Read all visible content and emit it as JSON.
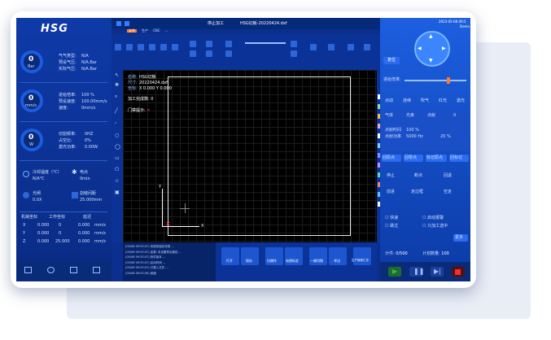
{
  "logo": "HSG",
  "left": {
    "gauges": [
      {
        "value": "0",
        "unit": "Bar"
      },
      {
        "value": "0",
        "unit": "mm/s"
      },
      {
        "value": "0",
        "unit": "W"
      }
    ],
    "gas_rows": [
      "气气类型:",
      "预设气压:",
      "实际气压:"
    ],
    "gas_vals": [
      "N/A",
      "N/A.Bar",
      "N/A.Bar"
    ],
    "speed_rows": [
      "进给倍率:",
      "预设速度:",
      "速度:"
    ],
    "speed_vals": [
      "100 %",
      "100.00mm/s",
      "0mm/s"
    ],
    "power_rows": [
      "切割频率:",
      "占空比:",
      "激光功率:"
    ],
    "power_vals": [
      "0HZ",
      "0%",
      "0.00W"
    ],
    "mid_items": [
      {
        "label": "冷却温度（℃）",
        "val": "N/A℃"
      },
      {
        "label": "电点",
        "val": "0min"
      },
      {
        "label": "光闸",
        "val": "0.0X"
      },
      {
        "label": "割缝间距",
        "val": "25.000mm"
      }
    ],
    "coord_headers": [
      "机械坐标",
      "工作坐标",
      "延迟",
      ""
    ],
    "coords": [
      {
        "axis": "X",
        "mech": "0.000",
        "work": "0",
        "delay": "0.000",
        "unit": "mm/s"
      },
      {
        "axis": "Y",
        "mech": "0.000",
        "work": "0",
        "delay": "0.000",
        "unit": "mm/s"
      },
      {
        "axis": "Z",
        "mech": "0.000",
        "work": "25.000",
        "delay": "0.000",
        "unit": "mm/s"
      }
    ]
  },
  "top": {
    "title": "HSG切板-20220424.dxf",
    "mode": "停止加工",
    "datetime": "2023-05-08 09:5",
    "user": "Demo",
    "tabs": [
      "文件",
      "生产",
      "CNC",
      "..."
    ]
  },
  "canvas": {
    "lines": [
      "HSG切板",
      "20220424.dxf",
      "X 0.000 Y 0.000",
      "加工完成数:  0",
      "门禁提示:"
    ],
    "labels": [
      "名称:",
      "尺寸:",
      "坐标:"
    ],
    "axis_y": "Y",
    "axis_x": "X"
  },
  "log": [
    "(05/08 09:53:07) 系统初始化完成 ...",
    "(05/08 09:53:07) 加载: 未设置导出路径 ...",
    "(05/08 09:53:07) 软件版本 ...",
    "(05/08 09:53:07) 启动时间 ...",
    "(05/08 09:53:07) 已载入文件 ...",
    "(05/08 09:53:09) 就绪"
  ],
  "bottom_buttons": [
    "打开",
    "保存",
    "拉跳作",
    "电视标定",
    "一键切割",
    "寻边",
    "生产报修汇总"
  ],
  "right": {
    "reset": "复位",
    "feed_label": "进给倍率:",
    "row1": [
      "点动",
      "连续",
      "吹气",
      "红光",
      "激光"
    ],
    "row2": [
      "气体",
      "光束",
      "点射",
      "0"
    ],
    "params": [
      {
        "k": "点射时间",
        "v": "100 %"
      },
      {
        "k": "点射功率",
        "v": "5000 Hz",
        "v2": "20 %"
      }
    ],
    "actions": [
      "回原点",
      "回零点",
      "标记原点",
      "回标记"
    ],
    "grid_buttons": [
      "停止",
      "断点",
      "回退",
      "前进",
      "走边框",
      "空走"
    ],
    "checks": [
      "快速",
      "启动报警",
      "跳过",
      "只加工选中"
    ],
    "count_label": "计件:",
    "count_val": "0/500",
    "total_label": "计划数量:",
    "total_val": "100",
    "more": "更多",
    "colors": {
      "start": "#2fbf4a",
      "pause": "#3b7bff",
      "stop": "#ff2a2a"
    }
  },
  "swatches": [
    "#ffffff",
    "#9bdc8c",
    "#f2c230",
    "#f3a2c9",
    "#ffffff",
    "#7fd0f0",
    "#8b8bff",
    "#c58bff",
    "#5fd6a8",
    "#f08080",
    "#60c0ff",
    "#ffffff"
  ]
}
